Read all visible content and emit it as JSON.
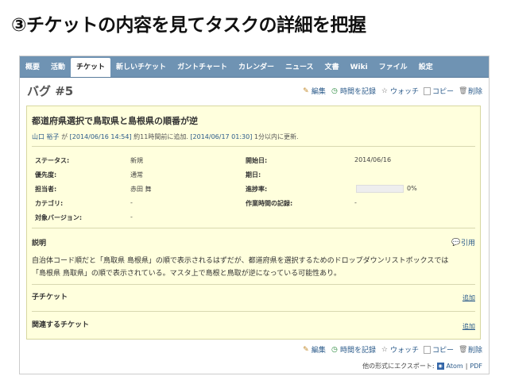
{
  "slide": {
    "title": "③チケットの内容を見てタスクの詳細を把握"
  },
  "tabs": [
    {
      "label": "概要"
    },
    {
      "label": "活動"
    },
    {
      "label": "チケット",
      "active": true
    },
    {
      "label": "新しいチケット"
    },
    {
      "label": "ガントチャート"
    },
    {
      "label": "カレンダー"
    },
    {
      "label": "ニュース"
    },
    {
      "label": "文書"
    },
    {
      "label": "Wiki"
    },
    {
      "label": "ファイル"
    },
    {
      "label": "設定"
    }
  ],
  "issue": {
    "title": "バグ #5",
    "subject": "都道府県選択で鳥取県と島根県の順番が逆",
    "author": {
      "name": "山口 裕子",
      "suffix": " が ",
      "created": "[2014/06/16 14:54]",
      "created_rel": " 約11時間前に追加. ",
      "updated": "[2014/06/17 01:30]",
      "updated_rel": " 1分以内に更新."
    },
    "attributes_left": [
      {
        "label": "ステータス:",
        "value": "新規"
      },
      {
        "label": "優先度:",
        "value": "通常"
      },
      {
        "label": "担当者:",
        "value": "赤田 舞"
      },
      {
        "label": "カテゴリ:",
        "value": "-"
      },
      {
        "label": "対象バージョン:",
        "value": "-"
      }
    ],
    "attributes_right": [
      {
        "label": "開始日:",
        "value": "2014/06/16"
      },
      {
        "label": "期日:",
        "value": ""
      },
      {
        "label": "進捗率:",
        "value": "0%"
      },
      {
        "label": "作業時間の記録:",
        "value": "-"
      }
    ],
    "progress": 0,
    "description_title": "説明",
    "quote_label": "引用",
    "description_line1": "自治体コード順だと「鳥取県 島根県」の順で表示されるはずだが、都道府県を選択するためのドロップダウンリストボックスでは",
    "description_line2": "「島根県 鳥取県」の順で表示されている。マスタ上で島根と鳥取が逆になっている可能性あり。",
    "subtasks_title": "子チケット",
    "related_title": "関連するチケット",
    "add_label": "追加"
  },
  "actions": {
    "edit": "編集",
    "log_time": "時間を記録",
    "watch": "ウォッチ",
    "copy": "コピー",
    "delete": "削除"
  },
  "export": {
    "label": "他の形式にエクスポート:",
    "atom": "Atom",
    "sep": "|",
    "pdf": "PDF"
  },
  "colors": {
    "tab_bar": "#6f93b3",
    "panel_bg": "#ffffdd",
    "link": "#2a5a8a"
  }
}
